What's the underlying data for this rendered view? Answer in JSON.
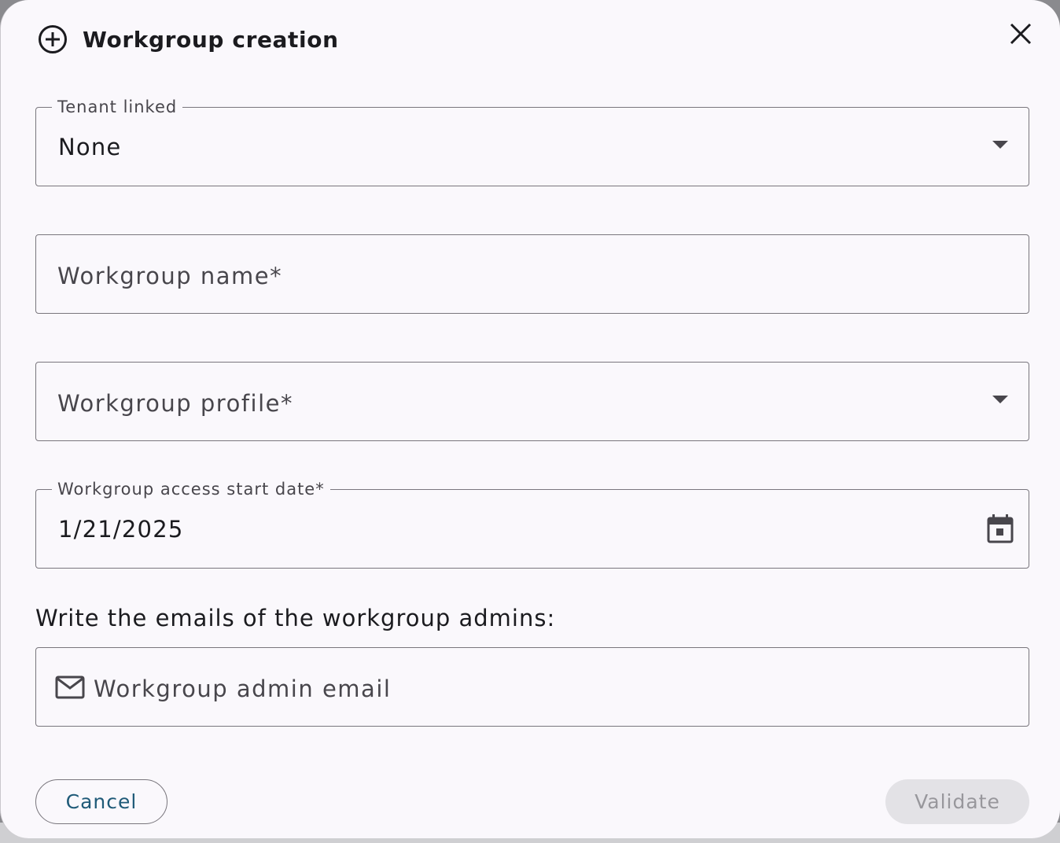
{
  "dialog": {
    "title": "Workgroup creation",
    "close_icon": "close-icon",
    "header_icon": "add-circle-icon"
  },
  "fields": {
    "tenant": {
      "label": "Tenant linked",
      "value": "None"
    },
    "name": {
      "placeholder": "Workgroup name*"
    },
    "profile": {
      "placeholder": "Workgroup profile*"
    },
    "start_date": {
      "label": "Workgroup access start date*",
      "value": "1/21/2025"
    },
    "admin_email": {
      "section_label": "Write the emails of the workgroup admins:",
      "placeholder": "Workgroup admin email"
    }
  },
  "actions": {
    "cancel_label": "Cancel",
    "validate_label": "Validate",
    "validate_disabled": true
  },
  "colors": {
    "dialog_bg": "#faf8fc",
    "border": "#79767d",
    "primary_text": "#1f5a78",
    "disabled_bg": "#e3e2e6",
    "disabled_text": "#98979c"
  }
}
